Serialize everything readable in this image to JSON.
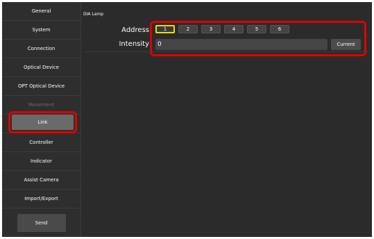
{
  "sidebar": {
    "items": [
      {
        "label": "General"
      },
      {
        "label": "System"
      },
      {
        "label": "Connection"
      },
      {
        "label": "Optical Device"
      },
      {
        "label": "OPT Optical Device"
      },
      {
        "label": "Movement",
        "state": "disabled"
      },
      {
        "label": "Link",
        "state": "selected"
      },
      {
        "label": "Controller"
      },
      {
        "label": "Indicator"
      },
      {
        "label": "Assist Camera"
      },
      {
        "label": "Import/Export"
      }
    ],
    "send_label": "Send"
  },
  "main": {
    "section_title": "DIA Lamp",
    "address": {
      "label": "Address",
      "options": [
        "1",
        "2",
        "3",
        "4",
        "5",
        "6"
      ],
      "selected": "1"
    },
    "intensity": {
      "label": "Intensity",
      "value": "0",
      "current_label": "Current"
    }
  },
  "colors": {
    "background": "#2b2b2b",
    "highlight": "#e00000",
    "selected_outline": "#e6e000",
    "selected_item": "#6a6a6a"
  }
}
